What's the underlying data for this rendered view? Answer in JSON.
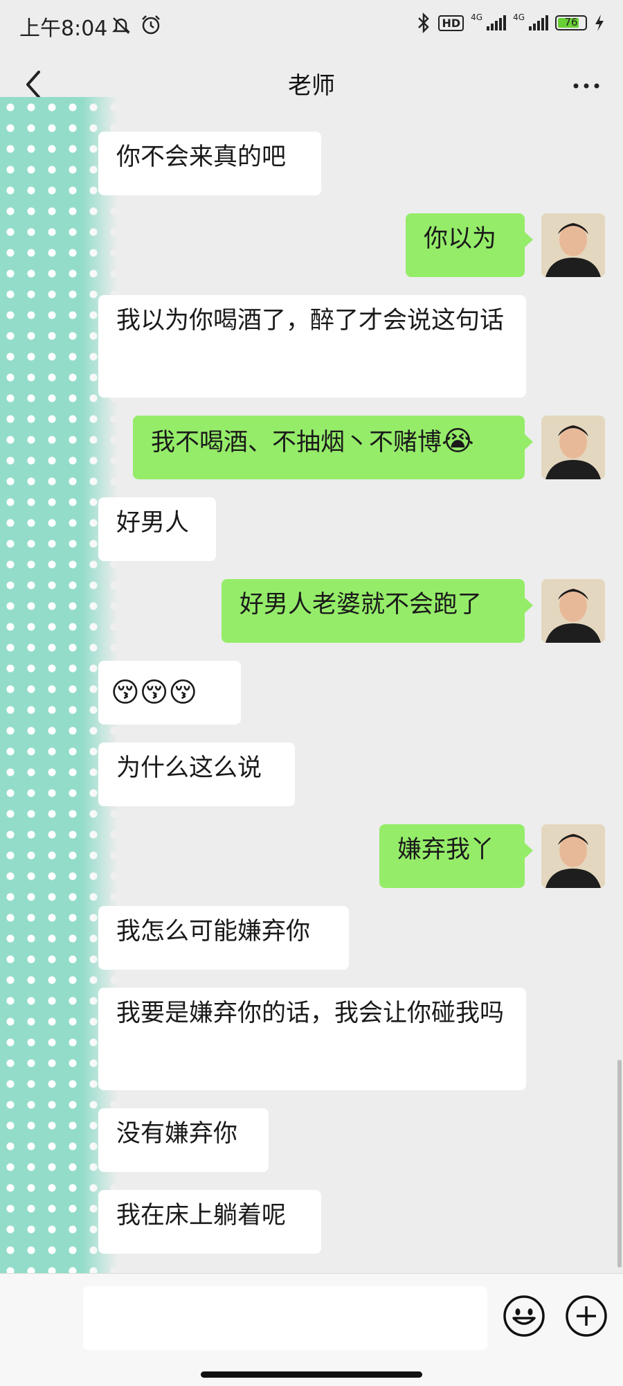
{
  "status_bar": {
    "time": "上午8:04",
    "hd_label": "HD",
    "network_1": "4G",
    "network_2": "4G",
    "battery": "76",
    "icons": [
      "mute-icon",
      "alarm-icon",
      "bluetooth-icon",
      "charging-icon"
    ]
  },
  "header": {
    "title": "老师",
    "back_icon": "chevron-left-icon",
    "more_icon": "more-dots-icon"
  },
  "messages": [
    {
      "from": "them",
      "text": "你不会来真的吧"
    },
    {
      "from": "me",
      "text": "你以为"
    },
    {
      "from": "them",
      "text": "我以为你喝酒了，醉了才会说这句话"
    },
    {
      "from": "me",
      "text": "我不喝酒、不抽烟丶不赌博",
      "emoji": "😭"
    },
    {
      "from": "them",
      "text": "好男人"
    },
    {
      "from": "me",
      "text": "好男人老婆就不会跑了"
    },
    {
      "from": "them",
      "emoji": "😚😚😚"
    },
    {
      "from": "them",
      "text": "为什么这么说"
    },
    {
      "from": "me",
      "text": "嫌弃我丫"
    },
    {
      "from": "them",
      "text": "我怎么可能嫌弃你"
    },
    {
      "from": "them",
      "text": "我要是嫌弃你的话，我会让你碰我吗"
    },
    {
      "from": "them",
      "text": "没有嫌弃你"
    },
    {
      "from": "them",
      "text": "我在床上躺着呢"
    }
  ],
  "input_bar": {
    "placeholder": "",
    "emoji_icon": "smiley-icon",
    "plus_icon": "plus-circle-icon"
  },
  "colors": {
    "background": "#ededed",
    "outgoing_bubble": "#95ec69",
    "incoming_bubble": "#ffffff",
    "decoration": "#8fdcc9"
  }
}
